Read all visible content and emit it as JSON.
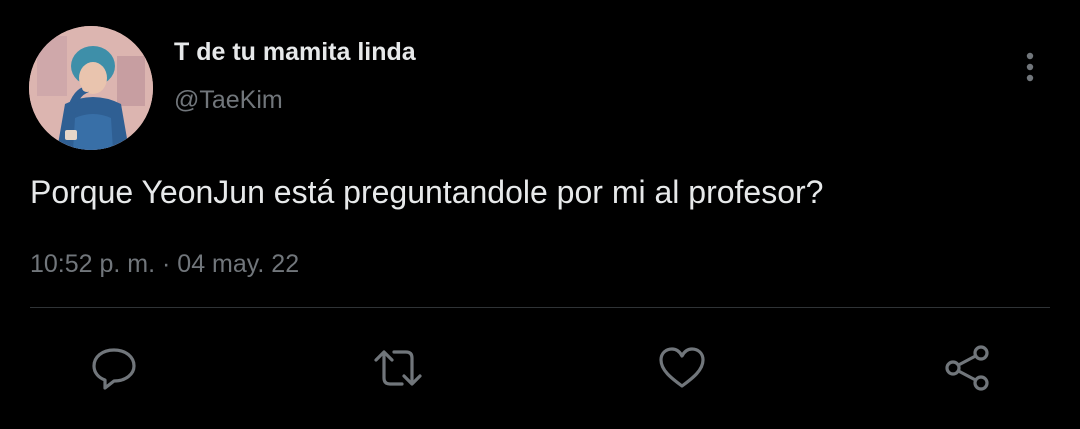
{
  "tweet": {
    "display_name": "T de tu mamita linda",
    "handle": "@TaeKim",
    "text": "Porque YeonJun está preguntandole por mi al profesor?",
    "timestamp": "10:52 p. m. · 04 may. 22"
  },
  "actions": [
    {
      "name": "reply",
      "icon": "speech-bubble-icon"
    },
    {
      "name": "retweet",
      "icon": "retweet-arrows-icon"
    },
    {
      "name": "like",
      "icon": "heart-icon"
    },
    {
      "name": "share",
      "icon": "share-nodes-icon"
    }
  ],
  "colors": {
    "background": "#000000",
    "primary_text": "#e7e9ea",
    "secondary_text": "#71767b",
    "icon": "#71767b",
    "divider": "#2f3336"
  }
}
